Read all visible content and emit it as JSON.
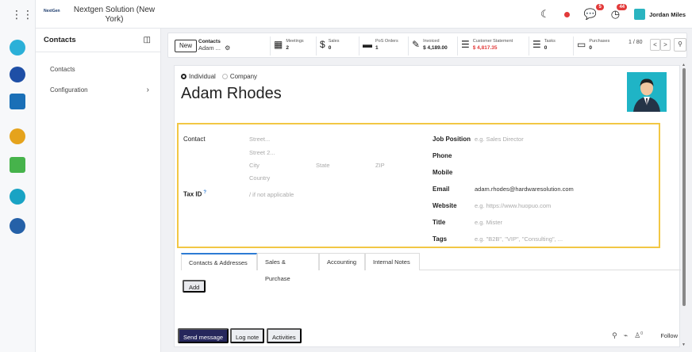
{
  "topbar": {
    "brand_logo": "NextGen",
    "brand_name": "Nextgen Solution (New York)",
    "messages_count": "5",
    "activities_count": "44",
    "user_name": "Jordan Miles"
  },
  "sidebar": {
    "title": "Contacts",
    "items": [
      {
        "label": "Contacts"
      },
      {
        "label": "Configuration"
      }
    ]
  },
  "control_panel": {
    "new_label": "New",
    "breadcrumb_parent": "Contacts",
    "breadcrumb_current": "Adam ...",
    "smart_buttons": [
      {
        "label": "Meetings",
        "value": "2",
        "icon": "calendar-icon"
      },
      {
        "label": "Sales",
        "value": "0",
        "icon": "dollar-icon"
      },
      {
        "label": "PoS Orders",
        "value": "1",
        "icon": "shop-icon"
      },
      {
        "label": "Invoiced",
        "value": "$ 4,189.00",
        "icon": "pencil-square-icon"
      },
      {
        "label": "Customer Statement",
        "value": "$ 4,817.35",
        "icon": "list-icon",
        "value_color": "#e23a3a"
      },
      {
        "label": "Tasks",
        "value": "0",
        "icon": "tasks-icon"
      },
      {
        "label": "Purchases",
        "value": "0",
        "icon": "credit-card-icon"
      }
    ],
    "pager": "1 / 80",
    "prev": "<",
    "next": ">"
  },
  "form": {
    "type_options": {
      "individual": "Individual",
      "company": "Company",
      "selected": "Individual"
    },
    "name": "Adam Rhodes",
    "contact_label": "Contact",
    "street_ph": "Street...",
    "street2_ph": "Street 2...",
    "city_ph": "City",
    "state_ph": "State",
    "zip_ph": "ZIP",
    "country_ph": "Country",
    "taxid_label": "Tax ID",
    "taxid_help": "?",
    "taxid_ph": "/ if not applicable",
    "job_label": "Job Position",
    "job_ph": "e.g. Sales Director",
    "phone_label": "Phone",
    "mobile_label": "Mobile",
    "email_label": "Email",
    "email_value": "adam.rhodes@hardwaresolution.com",
    "website_label": "Website",
    "website_ph": "e.g. https://www.huopuo.com",
    "title_label": "Title",
    "title_ph": "e.g. Mister",
    "tags_label": "Tags",
    "tags_ph": "e.g. \"B2B\", \"VIP\", \"Consulting\", ...",
    "highlight_color": "#f2c744"
  },
  "tabs": [
    "Contacts & Addresses",
    "Sales & Purchase",
    "Accounting",
    "Internal Notes"
  ],
  "add_label": "Add",
  "chatter": {
    "send": "Send message",
    "log": "Log note",
    "activities": "Activities",
    "followers_count": "0",
    "follow": "Follow"
  }
}
